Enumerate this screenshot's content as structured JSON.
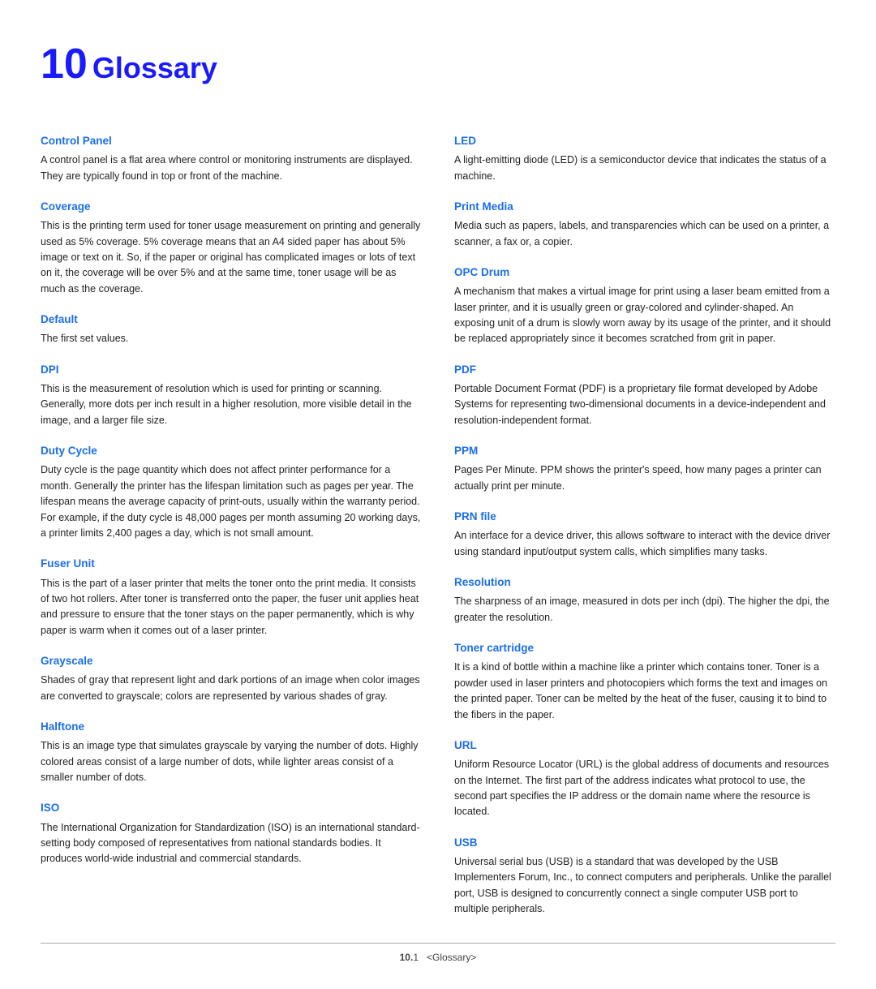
{
  "chapter": {
    "number": "10",
    "title": "Glossary"
  },
  "left_terms": [
    {
      "heading": "Control Panel",
      "body": "A control panel is a flat area where control or monitoring instruments are displayed. They are typically found in top or front of the machine."
    },
    {
      "heading": "Coverage",
      "body": "This is the printing term used for toner usage measurement on printing and generally used as 5% coverage. 5% coverage means that an A4 sided paper has about 5% image or text on it. So, if the paper or original has complicated images or lots of text on it, the coverage will be over 5% and at the same time, toner usage will be as much as the coverage."
    },
    {
      "heading": "Default",
      "body": "The first set values."
    },
    {
      "heading": "DPI",
      "body": "This is the measurement of resolution which is used for printing or scanning. Generally, more dots per inch result in a higher resolution, more visible detail in the image, and a larger file size."
    },
    {
      "heading": "Duty Cycle",
      "body": "Duty cycle is the page quantity which does not affect printer performance for a month. Generally the printer has the lifespan limitation such as pages per year. The lifespan means the average capacity of print-outs, usually within the warranty period. For example, if the duty cycle is 48,000 pages per month assuming 20 working days, a printer limits 2,400 pages a day, which is not small amount."
    },
    {
      "heading": "Fuser Unit",
      "body": "This is the part of a laser printer that melts the toner onto the print media. It consists of two hot rollers. After toner is transferred onto the paper, the fuser unit applies heat and pressure to ensure that the toner stays on the paper permanently, which is why paper is warm when it comes out of a laser printer."
    },
    {
      "heading": "Grayscale",
      "body": "Shades of gray that represent light and dark portions of an image when color images are converted to grayscale; colors are represented by various shades of gray."
    },
    {
      "heading": "Halftone",
      "body": "This is an image type that simulates grayscale by varying the number of dots. Highly colored areas consist of a large number of dots, while lighter areas consist of a smaller number of dots."
    },
    {
      "heading": "ISO",
      "body": "The International Organization for Standardization (ISO) is an international standard-setting body composed of representatives from national standards bodies. It produces world-wide industrial and commercial standards."
    }
  ],
  "right_terms": [
    {
      "heading": "LED",
      "body": "A light-emitting diode (LED) is a semiconductor device that indicates the status of a machine."
    },
    {
      "heading": "Print Media",
      "body": "Media such as papers, labels, and transparencies which can be used on a printer, a scanner, a fax or, a copier."
    },
    {
      "heading": "OPC Drum",
      "body": "A mechanism that makes a virtual image for print using a laser beam emitted from a laser printer, and it is usually green or gray-colored and cylinder-shaped. An exposing unit of a drum is slowly worn away by its usage of the printer, and it should be replaced appropriately since it becomes scratched from grit in paper."
    },
    {
      "heading": "PDF",
      "body": "Portable Document Format (PDF) is a proprietary file format developed by Adobe Systems for representing two-dimensional documents in a device-independent and resolution-independent format."
    },
    {
      "heading": "PPM",
      "body": "Pages Per Minute. PPM shows the printer's speed, how many pages a printer can actually print per minute."
    },
    {
      "heading": "PRN file",
      "body": "An interface for a device driver, this allows software to interact with the device driver using standard input/output system calls, which simplifies many tasks."
    },
    {
      "heading": "Resolution",
      "body": "The sharpness of an image, measured in dots per inch (dpi). The higher the dpi, the greater the resolution."
    },
    {
      "heading": "Toner cartridge",
      "body": "It is a kind of bottle within a machine like a printer which contains toner. Toner is a powder used in laser printers and photocopiers which forms the text and images on the printed paper. Toner can be melted by the heat of the fuser, causing it to bind to the fibers in the paper."
    },
    {
      "heading": "URL",
      "body": "Uniform Resource Locator (URL) is the global address of documents and resources on the Internet. The first part of the address indicates what protocol to use, the second part specifies the IP address or the domain name where the resource is located."
    },
    {
      "heading": "USB",
      "body": "Universal serial bus (USB) is a standard that was developed by the USB Implementers Forum, Inc., to connect computers and peripherals. Unlike the parallel port, USB is designed to concurrently connect a single computer USB port to multiple peripherals."
    }
  ],
  "footer": {
    "page_num": "10.",
    "page_sub": "1",
    "breadcrumb": "<Glossary>"
  }
}
